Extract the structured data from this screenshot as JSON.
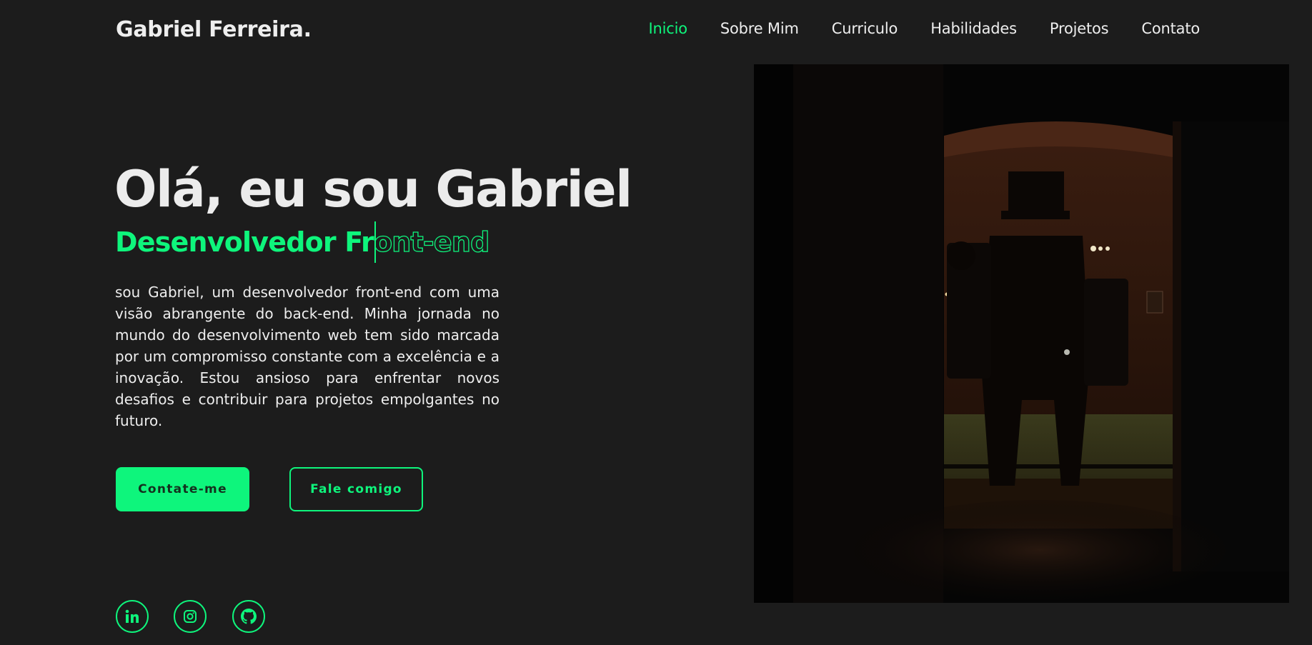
{
  "header": {
    "logo": "Gabriel Ferreira.",
    "nav": [
      {
        "label": "Inicio",
        "active": true
      },
      {
        "label": "Sobre Mim",
        "active": false
      },
      {
        "label": "Curriculo",
        "active": false
      },
      {
        "label": "Habilidades",
        "active": false
      },
      {
        "label": "Projetos",
        "active": false
      },
      {
        "label": "Contato",
        "active": false
      }
    ]
  },
  "hero": {
    "title": "Olá, eu sou Gabriel",
    "subtitle_typed": "Desenvolvedor Fr",
    "subtitle_rest": "ont-end",
    "bio": "sou Gabriel, um desenvolvedor front-end com uma visão abrangente do back-end. Minha jornada no mundo do desenvolvimento web tem sido marcada por um compromisso constante com a excelência e a inovação. Estou ansioso para enfrentar novos desafios e contribuir para projetos empolgantes no futuro.",
    "primary_button": "Contate-me",
    "secondary_button": "Fale comigo"
  },
  "social": [
    {
      "icon": "linkedin-icon"
    },
    {
      "icon": "instagram-icon"
    },
    {
      "icon": "github-icon"
    }
  ],
  "colors": {
    "accent": "#0ef57c",
    "background": "#1c1c1c",
    "text": "#eeeeee"
  }
}
